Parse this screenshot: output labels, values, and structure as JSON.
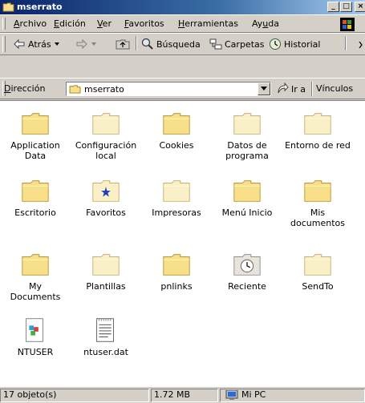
{
  "window": {
    "title": "mserrato"
  },
  "caption_buttons": {
    "minimize": "_",
    "maximize": "□",
    "close": "×"
  },
  "menubar": {
    "items": [
      {
        "label": "Archivo",
        "accel": "A",
        "rest": "rchivo"
      },
      {
        "label": "Edición",
        "accel": "E",
        "rest": "dición"
      },
      {
        "label": "Ver",
        "accel": "V",
        "rest": "er"
      },
      {
        "label": "Favoritos",
        "accel": "F",
        "rest": "avoritos"
      },
      {
        "label": "Herramientas",
        "accel": "H",
        "rest": "erramientas"
      },
      {
        "label": "Ayuda",
        "prefix": "Ay",
        "accel": "u",
        "rest": "da"
      }
    ]
  },
  "toolbar": {
    "back_label": "Atrás",
    "search_label": "Búsqueda",
    "folders_label": "Carpetas",
    "history_label": "Historial"
  },
  "address_bar": {
    "label_accel": "D",
    "label_rest": "irección",
    "value": "mserrato",
    "go_label": "Ir a",
    "links_label": "Vínculos"
  },
  "files": {
    "items": [
      {
        "label": "Application Data",
        "icon": "folder-icon"
      },
      {
        "label": "Configuración local",
        "icon": "folder-light-icon"
      },
      {
        "label": "Cookies",
        "icon": "folder-icon"
      },
      {
        "label": "Datos de programa",
        "icon": "folder-light-icon"
      },
      {
        "label": "Entorno de red",
        "icon": "folder-light-icon"
      },
      {
        "label": "Escritorio",
        "icon": "folder-icon"
      },
      {
        "label": "Favoritos",
        "icon": "favorites-folder-icon"
      },
      {
        "label": "Impresoras",
        "icon": "folder-light-icon"
      },
      {
        "label": "Menú Inicio",
        "icon": "folder-icon"
      },
      {
        "label": "Mis documentos",
        "icon": "folder-icon"
      },
      {
        "label": "My Documents",
        "icon": "folder-icon"
      },
      {
        "label": "Plantillas",
        "icon": "folder-light-icon"
      },
      {
        "label": "pnlinks",
        "icon": "folder-icon"
      },
      {
        "label": "Reciente",
        "icon": "recent-folder-icon"
      },
      {
        "label": "SendTo",
        "icon": "folder-light-icon"
      },
      {
        "label": "NTUSER",
        "icon": "registry-file-icon"
      },
      {
        "label": "ntuser.dat",
        "icon": "text-document-icon"
      }
    ]
  },
  "statusbar": {
    "count": "17 objeto(s)",
    "size": "1.72 MB",
    "zone": "Mi PC"
  },
  "colors": {
    "title_gradient_start": "#0a246a",
    "title_gradient_end": "#a6caf0",
    "chrome": "#d4d0c8",
    "folder": "#f8e08a",
    "folder_light": "#faf0c8"
  }
}
